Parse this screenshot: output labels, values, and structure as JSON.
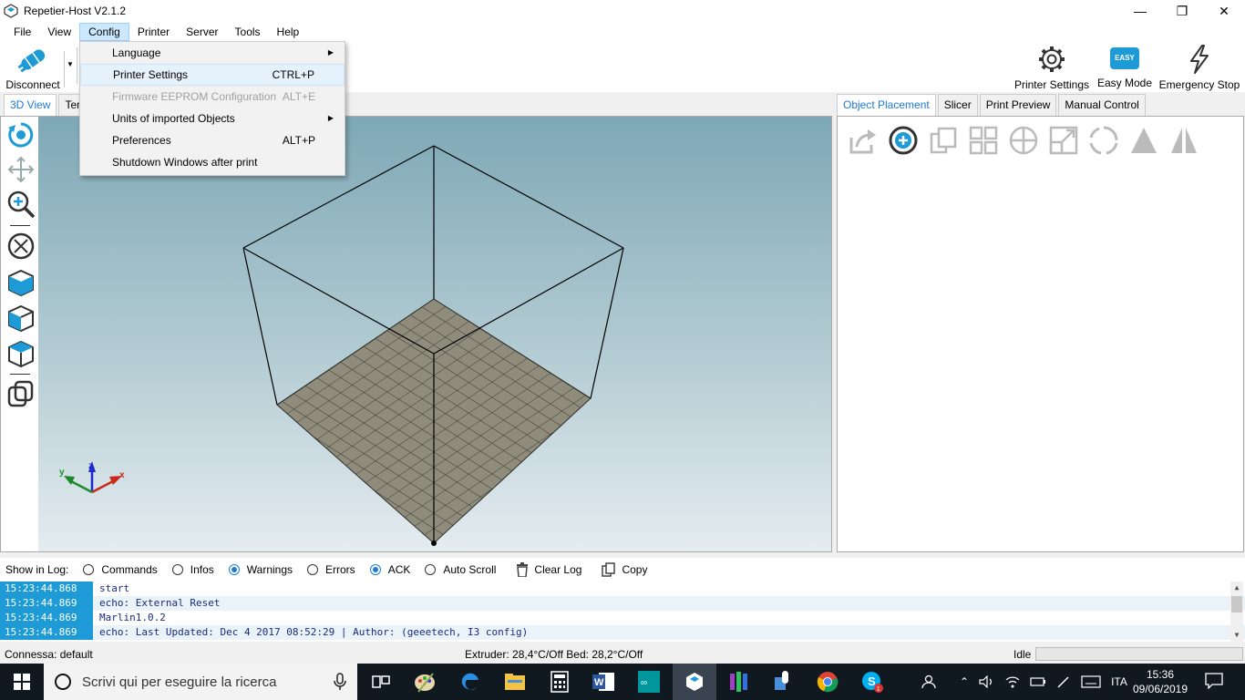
{
  "window": {
    "title": "Repetier-Host V2.1.2"
  },
  "menubar": [
    "File",
    "View",
    "Config",
    "Printer",
    "Server",
    "Tools",
    "Help"
  ],
  "toolbar": {
    "disconnect": "Disconnect",
    "printer_settings": "Printer Settings",
    "easy_badge": "EASY",
    "easy_mode": "Easy Mode",
    "emergency_stop": "Emergency Stop"
  },
  "left_tabs": [
    "3D View",
    "Tem"
  ],
  "right_tabs": [
    "Object Placement",
    "Slicer",
    "Print Preview",
    "Manual Control"
  ],
  "config_menu": [
    {
      "label": "Language",
      "shortcut": "",
      "submenu": true,
      "disabled": false
    },
    {
      "label": "Printer Settings",
      "shortcut": "CTRL+P",
      "submenu": false,
      "disabled": false,
      "highlight": true
    },
    {
      "label": "Firmware EEPROM Configuration",
      "shortcut": "ALT+E",
      "submenu": false,
      "disabled": true
    },
    {
      "label": "Units of imported Objects",
      "shortcut": "",
      "submenu": true,
      "disabled": false
    },
    {
      "label": "Preferences",
      "shortcut": "ALT+P",
      "submenu": false,
      "disabled": false
    },
    {
      "label": "Shutdown Windows after print",
      "shortcut": "",
      "submenu": false,
      "disabled": false
    }
  ],
  "log_bar": {
    "show_in_log": "Show in Log:",
    "options": [
      {
        "label": "Commands",
        "checked": false
      },
      {
        "label": "Infos",
        "checked": false
      },
      {
        "label": "Warnings",
        "checked": true
      },
      {
        "label": "Errors",
        "checked": false
      },
      {
        "label": "ACK",
        "checked": true
      },
      {
        "label": "Auto Scroll",
        "checked": false
      }
    ],
    "clear_log": "Clear Log",
    "copy": "Copy"
  },
  "log": [
    {
      "time": "15:23:44.868",
      "msg": "start"
    },
    {
      "time": "15:23:44.869",
      "msg": "echo: External Reset"
    },
    {
      "time": "15:23:44.869",
      "msg": "Marlin1.0.2"
    },
    {
      "time": "15:23:44.869",
      "msg": "echo: Last Updated: Dec  4 2017 08:52:29 | Author: (geeetech, I3 config)"
    }
  ],
  "status": {
    "connection": "Connessa: default",
    "extruder": "Extruder: 28,4°C/Off Bed: 28,2°C/Off",
    "state": "Idle"
  },
  "taskbar": {
    "search_placeholder": "Scrivi qui per eseguire la ricerca",
    "language": "ITA",
    "time": "15:36",
    "date": "09/06/2019",
    "skype_badge": "1"
  },
  "colors": {
    "accent": "#1e9bd7",
    "bed": "#8f8c7c",
    "viewport_top": "#7ea8b6"
  }
}
